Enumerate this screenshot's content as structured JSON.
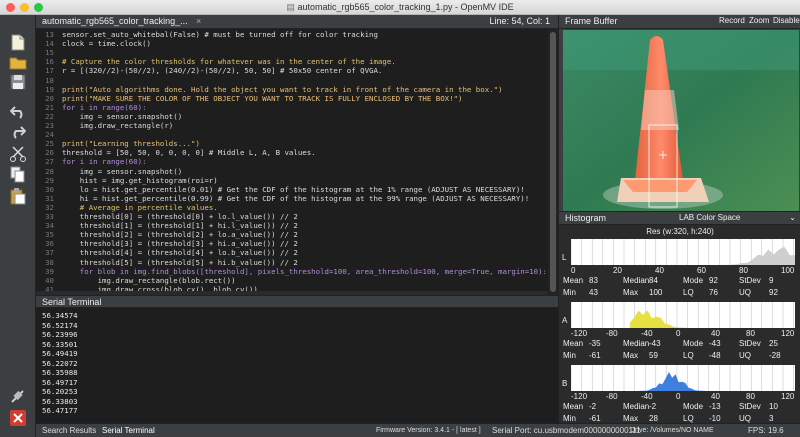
{
  "window": {
    "title": "automatic_rgb565_color_tracking_1.py - OpenMV IDE"
  },
  "editor": {
    "tab_name": "automatic_rgb565_color_tracking_...",
    "close_glyph": "×",
    "line_col": "Line: 54, Col: 1",
    "lines": [
      {
        "n": "13",
        "text": "sensor.set_auto_whitebal(False) # must be turned off for color tracking"
      },
      {
        "n": "14",
        "text": "clock = time.clock()"
      },
      {
        "n": "15",
        "text": ""
      },
      {
        "n": "16",
        "text": "# Capture the color thresholds for whatever was in the center of the image."
      },
      {
        "n": "17",
        "text": "r = [(320//2)-(50//2), (240//2)-(50//2), 50, 50] # 50x50 center of QVGA."
      },
      {
        "n": "18",
        "text": ""
      },
      {
        "n": "19",
        "text": "print(\"Auto algorithms done. Hold the object you want to track in front of the camera in the box.\")"
      },
      {
        "n": "20",
        "text": "print(\"MAKE SURE THE COLOR OF THE OBJECT YOU WANT TO TRACK IS FULLY ENCLOSED BY THE BOX!\")"
      },
      {
        "n": "21",
        "text": "for i in range(60):"
      },
      {
        "n": "22",
        "text": "    img = sensor.snapshot()"
      },
      {
        "n": "23",
        "text": "    img.draw_rectangle(r)"
      },
      {
        "n": "24",
        "text": ""
      },
      {
        "n": "25",
        "text": "print(\"Learning thresholds...\")"
      },
      {
        "n": "26",
        "text": "threshold = [50, 50, 0, 0, 0, 0] # Middle L, A, B values."
      },
      {
        "n": "27",
        "text": "for i in range(60):"
      },
      {
        "n": "28",
        "text": "    img = sensor.snapshot()"
      },
      {
        "n": "29",
        "text": "    hist = img.get_histogram(roi=r)"
      },
      {
        "n": "30",
        "text": "    lo = hist.get_percentile(0.01) # Get the CDF of the histogram at the 1% range (ADJUST AS NECESSARY)!"
      },
      {
        "n": "31",
        "text": "    hi = hist.get_percentile(0.99) # Get the CDF of the histogram at the 99% range (ADJUST AS NECESSARY)!"
      },
      {
        "n": "32",
        "text": "    # Average in percentile values."
      },
      {
        "n": "33",
        "text": "    threshold[0] = (threshold[0] + lo.l_value()) // 2"
      },
      {
        "n": "34",
        "text": "    threshold[1] = (threshold[1] + hi.l_value()) // 2"
      },
      {
        "n": "35",
        "text": "    threshold[2] = (threshold[2] + lo.a_value()) // 2"
      },
      {
        "n": "36",
        "text": "    threshold[3] = (threshold[3] + hi.a_value()) // 2"
      },
      {
        "n": "37",
        "text": "    threshold[4] = (threshold[4] + lo.b_value()) // 2"
      },
      {
        "n": "38",
        "text": "    threshold[5] = (threshold[5] + hi.b_value()) // 2"
      },
      {
        "n": "39",
        "text": "    for blob in img.find_blobs([threshold], pixels_threshold=100, area_threshold=100, merge=True, margin=10):"
      },
      {
        "n": "40",
        "text": "        img.draw_rectangle(blob.rect())"
      },
      {
        "n": "41",
        "text": "        img.draw_cross(blob.cx(), blob.cy())"
      }
    ]
  },
  "terminal": {
    "title": "Serial Terminal",
    "lines": [
      "56.34574",
      "56.52174",
      "56.23996",
      "56.33501",
      "56.49419",
      "56.22072",
      "56.35988",
      "56.49717",
      "56.20253",
      "56.33803",
      "56.47177"
    ]
  },
  "bottom": {
    "tab_search": "Search Results",
    "tab_serial": "Serial Terminal",
    "firmware": "Firmware Version: 3.4.1 - [ latest ]",
    "serial_port": "Serial Port: cu.usbmodem0000000000111",
    "drive": "Drive: /Volumes/NO NAME",
    "fps": "FPS: 19.6"
  },
  "framebuffer": {
    "title": "Frame Buffer",
    "record": "Record",
    "zoom": "Zoom",
    "disable": "Disable"
  },
  "histogram": {
    "title": "Histogram",
    "color_space": "LAB Color Space",
    "resolution": "Res (w:320, h:240)",
    "channels": [
      {
        "name": "L",
        "ticks": [
          "0",
          "20",
          "40",
          "60",
          "80",
          "100"
        ],
        "stats": {
          "mean": "83",
          "median": "84",
          "mode": "92",
          "stdev": "9",
          "min": "43",
          "max": "100",
          "lq": "76",
          "uq": "92"
        }
      },
      {
        "name": "A",
        "ticks": [
          "-120",
          "-80",
          "-40",
          "0",
          "40",
          "80",
          "120"
        ],
        "stats": {
          "mean": "-35",
          "median": "-43",
          "mode": "-43",
          "stdev": "25",
          "min": "-61",
          "max": "59",
          "lq": "-48",
          "uq": "-28"
        }
      },
      {
        "name": "B",
        "ticks": [
          "-120",
          "-80",
          "-40",
          "0",
          "40",
          "80",
          "120"
        ],
        "stats": {
          "mean": "-2",
          "median": "-2",
          "mode": "-13",
          "stdev": "10",
          "min": "-61",
          "max": "28",
          "lq": "-10",
          "uq": "3"
        }
      }
    ],
    "labels": {
      "mean": "Mean",
      "median": "Median",
      "mode": "Mode",
      "stdev": "StDev",
      "min": "Min",
      "max": "Max",
      "lq": "LQ",
      "uq": "UQ"
    }
  },
  "colors": {
    "accent": "#4a90d9",
    "l_channel": "#cfcfcf",
    "a_channel": "#e6e042",
    "b_channel": "#3f7fe0"
  }
}
